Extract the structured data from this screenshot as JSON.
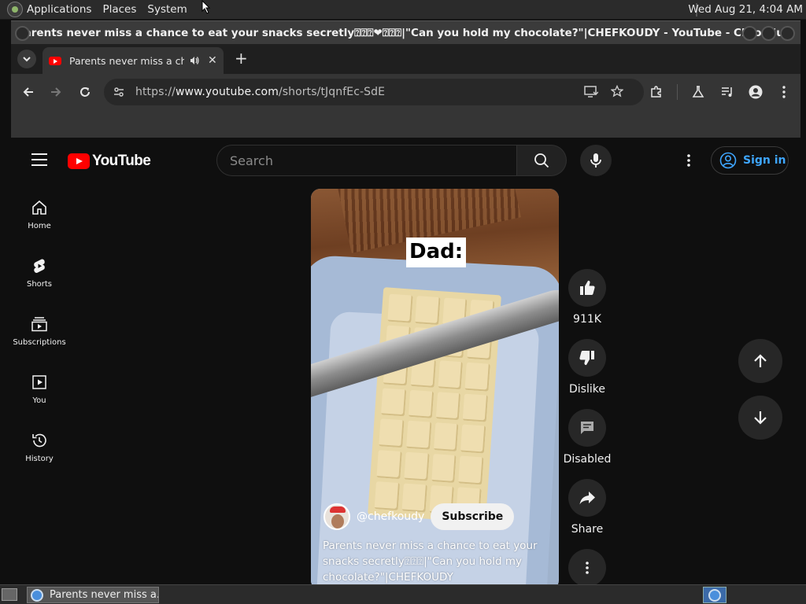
{
  "os": {
    "menus": [
      "Applications",
      "Places",
      "System"
    ],
    "clock": "Wed Aug 21,  4:04 AM"
  },
  "window": {
    "title": "Parents never miss a chance to eat your snacks secretly⍰⍰⍰❤⍰⍰⍰|\"Can you hold my chocolate?\"|CHEFKOUDY - YouTube - Chromium"
  },
  "tab": {
    "title": "Parents never miss a chance to eat your snacks secretly",
    "close": "✕",
    "new_tab": "+"
  },
  "address_bar": {
    "scheme": "https://",
    "host": "www.youtube.com",
    "path": "/shorts/tJqnfEc-SdE"
  },
  "youtube": {
    "logo_text": "YouTube",
    "search_placeholder": "Search",
    "sign_in": "Sign in",
    "sidebar": [
      {
        "label": "Home",
        "icon": "home-icon"
      },
      {
        "label": "Shorts",
        "icon": "shorts-icon"
      },
      {
        "label": "Subscriptions",
        "icon": "subscriptions-icon"
      },
      {
        "label": "You",
        "icon": "you-icon"
      },
      {
        "label": "History",
        "icon": "history-icon"
      }
    ]
  },
  "short": {
    "overlay_caption": "Dad:",
    "channel_handle": "@chefkoudy",
    "subscribe_label": "Subscribe",
    "description": "Parents never miss a chance to eat your snacks secretly⍰⍰⍰|\"Can you hold my chocolate?\"|CHEFKOUDY",
    "actions": [
      {
        "label": "911K",
        "icon": "like-icon"
      },
      {
        "label": "Dislike",
        "icon": "dislike-icon"
      },
      {
        "label": "Disabled",
        "icon": "comments-icon"
      },
      {
        "label": "Share",
        "icon": "share-icon"
      }
    ]
  },
  "taskbar": {
    "window_button": "Parents never miss a..."
  },
  "colors": {
    "yt_red": "#ff0000",
    "sign_in_blue": "#3ea6ff",
    "page_bg": "#0f0f0f"
  }
}
